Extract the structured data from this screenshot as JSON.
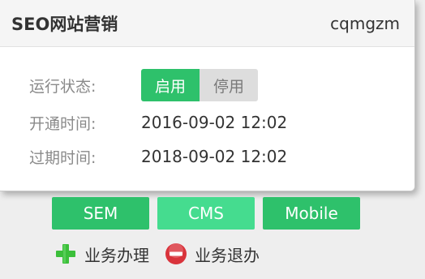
{
  "header": {
    "title": "SEO网站营销",
    "user": "cqmgzm"
  },
  "status": {
    "label": "运行状态:",
    "enable": "启用",
    "disable": "停用"
  },
  "open_time": {
    "label": "开通时间:",
    "value": "2016-09-02 12:02"
  },
  "expire_time": {
    "label": "过期时间:",
    "value": "2018-09-02 12:02"
  },
  "tags": [
    "SEM",
    "CMS",
    "Mobile"
  ],
  "actions": {
    "handle": "业务办理",
    "cancel": "业务退办"
  },
  "colors": {
    "accent": "#2ec16b",
    "accent_light": "#45dc8f",
    "danger": "#d9333b",
    "plus": "#3bbf3a"
  }
}
